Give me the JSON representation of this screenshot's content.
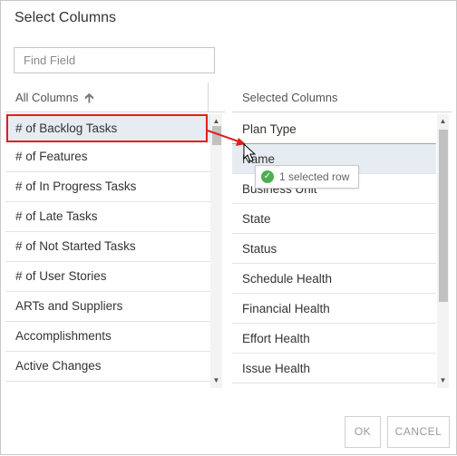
{
  "dialog": {
    "title": "Select Columns",
    "search_placeholder": "Find Field",
    "ok_label": "OK",
    "cancel_label": "CANCEL"
  },
  "left": {
    "header": "All Columns",
    "sort_icon": "sort-ascending-arrow",
    "items": [
      "# of Backlog Tasks",
      "# of Features",
      "# of In Progress Tasks",
      "# of Late Tasks",
      "# of Not Started Tasks",
      "# of User Stories",
      "ARTs and Suppliers",
      "Accomplishments",
      "Active Changes"
    ]
  },
  "right": {
    "header": "Selected Columns",
    "items": [
      "Plan Type",
      "Name",
      "Business Unit",
      "State",
      "Status",
      "Schedule Health",
      "Financial Health",
      "Effort Health",
      "Issue Health"
    ]
  },
  "drag": {
    "tooltip": "1 selected row"
  },
  "colors": {
    "highlight": "#e0201b",
    "selected_row": "#e6ecf2",
    "drop_line": "#7fbf7f",
    "check": "#4caf50"
  }
}
